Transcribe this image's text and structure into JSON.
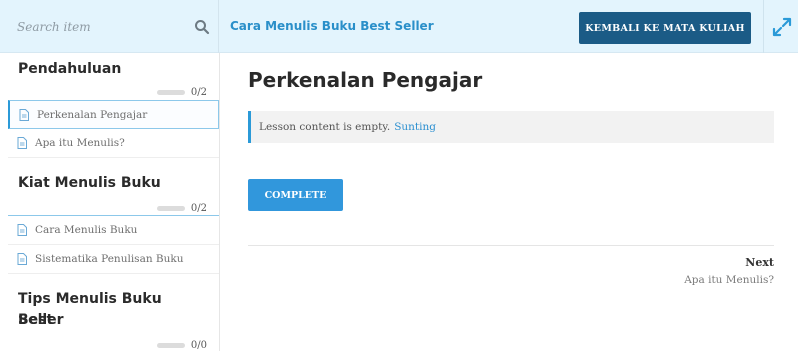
{
  "header": {
    "search_placeholder": "Search item",
    "search_icon": "search-icon",
    "course_title": "Cara Menulis Buku Best Seller",
    "back_button_label": "KEMBALI KE MATA KULIAH",
    "expand_icon": "expand-icon"
  },
  "sidebar": {
    "sections": [
      {
        "title": "Pendahuluan",
        "progress_text": "0/2",
        "progress": 0,
        "lessons": [
          {
            "label": "Perkenalan Pengajar",
            "icon": "document-icon",
            "active": true
          },
          {
            "label": "Apa itu Menulis?",
            "icon": "document-icon",
            "active": false
          }
        ]
      },
      {
        "title": "Kiat Menulis Buku",
        "progress_text": "0/2",
        "progress": 0,
        "lessons": [
          {
            "label": "Cara Menulis Buku",
            "icon": "document-icon",
            "active": false
          },
          {
            "label": "Sistematika Penulisan Buku",
            "icon": "document-icon",
            "active": false
          }
        ]
      },
      {
        "title_line1": "Tips Menulis Buku Best",
        "title_line2": "Seller",
        "progress_text": "0/0",
        "progress": 0
      }
    ]
  },
  "main": {
    "lesson_title": "Perkenalan Pengajar",
    "notice_text": "Lesson content is empty.",
    "notice_link": "Sunting",
    "complete_label": "COMPLETE",
    "next_label": "Next",
    "next_lesson": "Apa itu Menulis?"
  },
  "colors": {
    "header_bg": "#e3f4fd",
    "accent": "#2b9ad8",
    "back_button": "#1b5b86",
    "complete_button": "#3197dc"
  }
}
